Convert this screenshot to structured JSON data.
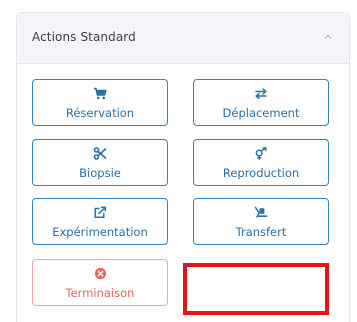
{
  "panel": {
    "title": "Actions Standard"
  },
  "actions": [
    {
      "label": "Réservation",
      "icon": "cart-icon"
    },
    {
      "label": "Déplacement",
      "icon": "arrows-exchange-icon"
    },
    {
      "label": "Biopsie",
      "icon": "scissors-icon"
    },
    {
      "label": "Reproduction",
      "icon": "gender-symbol-icon"
    },
    {
      "label": "Expérimentation",
      "icon": "external-edit-icon"
    },
    {
      "label": "Transfert",
      "icon": "transfer-icon"
    },
    {
      "label": "Terminaison",
      "icon": "cancel-circle-icon"
    }
  ],
  "colors": {
    "accent": "#2f86c4",
    "danger": "#e06a5f",
    "highlight": "#e8141b"
  }
}
